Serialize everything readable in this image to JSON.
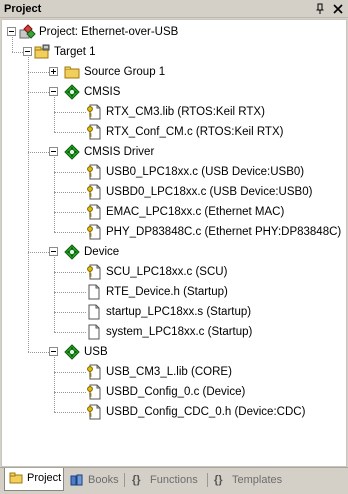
{
  "panel": {
    "title": "Project",
    "pin_icon": "pin-icon",
    "close_icon": "close-icon"
  },
  "tree": {
    "project_label": "Project: Ethernet-over-USB",
    "target_label": "Target 1",
    "groups": [
      {
        "label": "Source Group 1",
        "expanded": false,
        "files": []
      },
      {
        "label": "CMSIS",
        "expanded": true,
        "files": [
          "RTX_CM3.lib (RTOS:Keil RTX)",
          "RTX_Conf_CM.c (RTOS:Keil RTX)"
        ]
      },
      {
        "label": "CMSIS Driver",
        "expanded": true,
        "files": [
          "USB0_LPC18xx.c (USB Device:USB0)",
          "USBD0_LPC18xx.c (USB Device:USB0)",
          "EMAC_LPC18xx.c (Ethernet MAC)",
          "PHY_DP83848C.c (Ethernet PHY:DP83848C)"
        ]
      },
      {
        "label": "Device",
        "expanded": true,
        "files": [
          "SCU_LPC18xx.c (SCU)",
          "RTE_Device.h (Startup)",
          "startup_LPC18xx.s (Startup)",
          "system_LPC18xx.c (Startup)"
        ]
      },
      {
        "label": "USB",
        "expanded": true,
        "files": [
          "USB_CM3_L.lib (CORE)",
          "USBD_Config_0.c (Device)",
          "USBD_Config_CDC_0.h (Device:CDC)"
        ]
      }
    ]
  },
  "tabs": [
    {
      "label": "Project",
      "active": true
    },
    {
      "label": "Books",
      "active": false
    },
    {
      "label": "Functions",
      "active": false
    },
    {
      "label": "Templates",
      "active": false
    }
  ],
  "colors": {
    "panel_bg": "#d4d0c8",
    "tree_bg": "#ffffff",
    "component_green": "#22a822",
    "folder_yellow": "#f2cf5a",
    "key_yellow": "#e8c000"
  }
}
